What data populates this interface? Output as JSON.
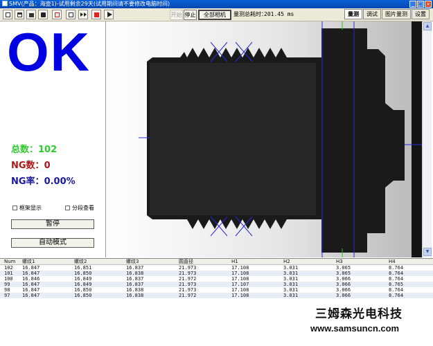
{
  "window": {
    "title": "SMV(产品：海壶1)-试用剩余29天(试用期间请不要修改电脑时间)"
  },
  "toolbar": {
    "icons": [
      "new-icon",
      "open-icon",
      "folder-icon",
      "camera-icon",
      "image-icon",
      "video-icon",
      "fast-forward-icon",
      "stop-icon",
      "play-icon"
    ],
    "start_label": "开始",
    "stop_label": "停止",
    "all_cameras_label": "全部相机",
    "time_label": "量测总耗时：",
    "time_value": "201.45 ms"
  },
  "tabs": [
    "量测",
    "调试",
    "图片量测",
    "设置"
  ],
  "result": {
    "status": "OK",
    "total_label": "总数：",
    "total_value": "102",
    "ng_label": "NG数：",
    "ng_value": "0",
    "rate_label": "NG率：",
    "rate_value": "0.00%"
  },
  "options": {
    "frame_display": "框架显示",
    "step_view": "分段查看"
  },
  "buttons": {
    "pause": "暂停",
    "auto_mode": "自动模式"
  },
  "table": {
    "columns": [
      "Num",
      "螺纹1",
      "螺纹2",
      "螺纹3",
      "圆直径",
      "H1",
      "H2",
      "H3",
      "H4"
    ],
    "rows": [
      [
        "102",
        "16.847",
        "16.851",
        "16.837",
        "21.973",
        "17.108",
        "3.031",
        "3.065",
        "8.764"
      ],
      [
        "101",
        "16.847",
        "16.850",
        "16.838",
        "21.973",
        "17.108",
        "3.031",
        "3.065",
        "8.764"
      ],
      [
        "100",
        "16.846",
        "16.849",
        "16.837",
        "21.972",
        "17.108",
        "3.031",
        "3.066",
        "8.764"
      ],
      [
        "99",
        "16.847",
        "16.849",
        "16.837",
        "21.973",
        "17.107",
        "3.031",
        "3.066",
        "8.765"
      ],
      [
        "98",
        "16.847",
        "16.850",
        "16.838",
        "21.973",
        "17.108",
        "3.031",
        "3.066",
        "8.764"
      ],
      [
        "97",
        "16.847",
        "16.850",
        "16.838",
        "21.972",
        "17.108",
        "3.031",
        "3.066",
        "8.764"
      ]
    ]
  },
  "watermark": {
    "cn": "三姆森光电科技",
    "url": "www.samsuncn.com"
  },
  "colors": {
    "ok": "#0000e0",
    "total": "#2ecc2e",
    "ng": "#b01818",
    "rate": "#1a1aa0",
    "titlebar": "#0a5fd8",
    "measure_lines": "#2a2ae0"
  }
}
